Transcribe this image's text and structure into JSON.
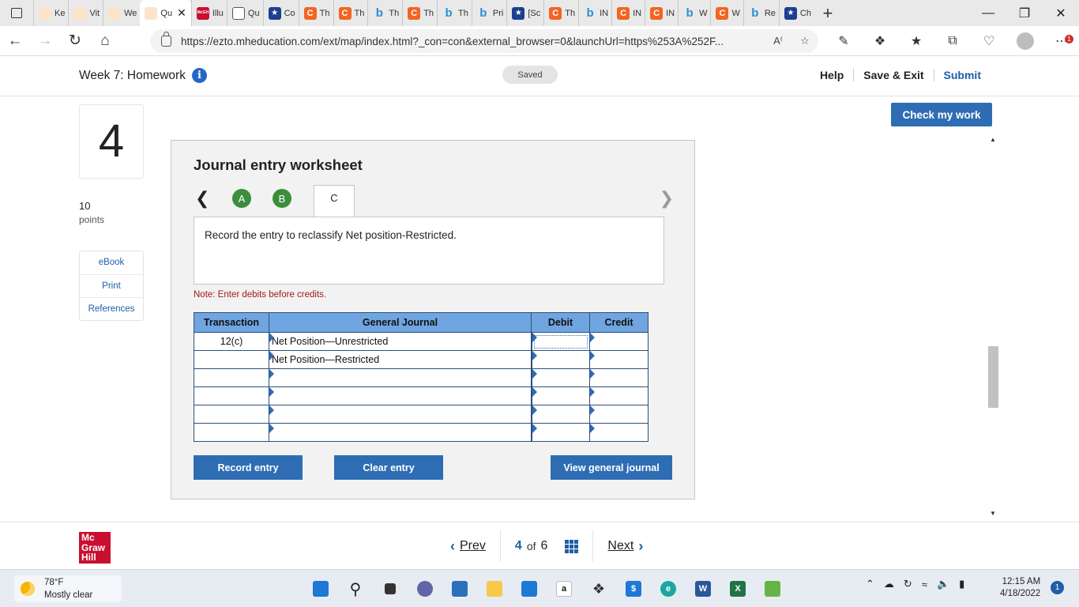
{
  "browser": {
    "tabs": [
      {
        "label": "Ke",
        "icon": "pale"
      },
      {
        "label": "Vit",
        "icon": "pale"
      },
      {
        "label": "We",
        "icon": "pale"
      },
      {
        "label": "Qu",
        "icon": "active"
      },
      {
        "label": "Illu",
        "icon": "mgh"
      },
      {
        "label": "Qu",
        "icon": "doc"
      },
      {
        "label": "Co",
        "icon": "navy"
      },
      {
        "label": "Th",
        "icon": "orange"
      },
      {
        "label": "Th",
        "icon": "orange"
      },
      {
        "label": "Th",
        "icon": "bing"
      },
      {
        "label": "Th",
        "icon": "orange"
      },
      {
        "label": "Th",
        "icon": "bing"
      },
      {
        "label": "Pri",
        "icon": "bing"
      },
      {
        "label": "[Sc",
        "icon": "navy"
      },
      {
        "label": "Th",
        "icon": "orange"
      },
      {
        "label": "IN",
        "icon": "bing"
      },
      {
        "label": "IN",
        "icon": "orange"
      },
      {
        "label": "IN",
        "icon": "orange"
      },
      {
        "label": "W",
        "icon": "bing"
      },
      {
        "label": "W",
        "icon": "orange"
      },
      {
        "label": "Re",
        "icon": "bing"
      },
      {
        "label": "Ch",
        "icon": "navy"
      }
    ],
    "url": "https://ezto.mheducation.com/ext/map/index.html?_con=con&external_browser=0&launchUrl=https%253A%252F...",
    "notification_count": "1"
  },
  "header": {
    "title": "Week 7: Homework",
    "saved": "Saved",
    "help": "Help",
    "save_exit": "Save & Exit",
    "submit": "Submit"
  },
  "question": {
    "number": "4",
    "points": "10",
    "points_label": "points",
    "links": [
      "eBook",
      "Print",
      "References"
    ]
  },
  "check_my_work": "Check my work",
  "worksheet": {
    "title": "Journal entry worksheet",
    "steps": [
      "A",
      "B",
      "C"
    ],
    "active_step": "C",
    "prompt": "Record the entry to reclassify Net position-Restricted.",
    "note": "Note: Enter debits before credits.",
    "columns": [
      "Transaction",
      "General Journal",
      "Debit",
      "Credit"
    ],
    "rows": [
      {
        "transaction": "12(c)",
        "account": "Net Position—Unrestricted",
        "debit": "",
        "credit": ""
      },
      {
        "transaction": "",
        "account": "Net Position—Restricted",
        "debit": "",
        "credit": ""
      },
      {
        "transaction": "",
        "account": "",
        "debit": "",
        "credit": ""
      },
      {
        "transaction": "",
        "account": "",
        "debit": "",
        "credit": ""
      },
      {
        "transaction": "",
        "account": "",
        "debit": "",
        "credit": ""
      },
      {
        "transaction": "",
        "account": "",
        "debit": "",
        "credit": ""
      }
    ],
    "buttons": {
      "record": "Record entry",
      "clear": "Clear entry",
      "view": "View general journal"
    }
  },
  "footer": {
    "logo": [
      "Mc",
      "Graw",
      "Hill"
    ],
    "prev": "Prev",
    "current": "4",
    "of": "of",
    "total": "6",
    "next": "Next"
  },
  "taskbar": {
    "temperature": "78°F",
    "weather": "Mostly clear",
    "time": "12:15 AM",
    "date": "4/18/2022",
    "notifications": "1"
  }
}
